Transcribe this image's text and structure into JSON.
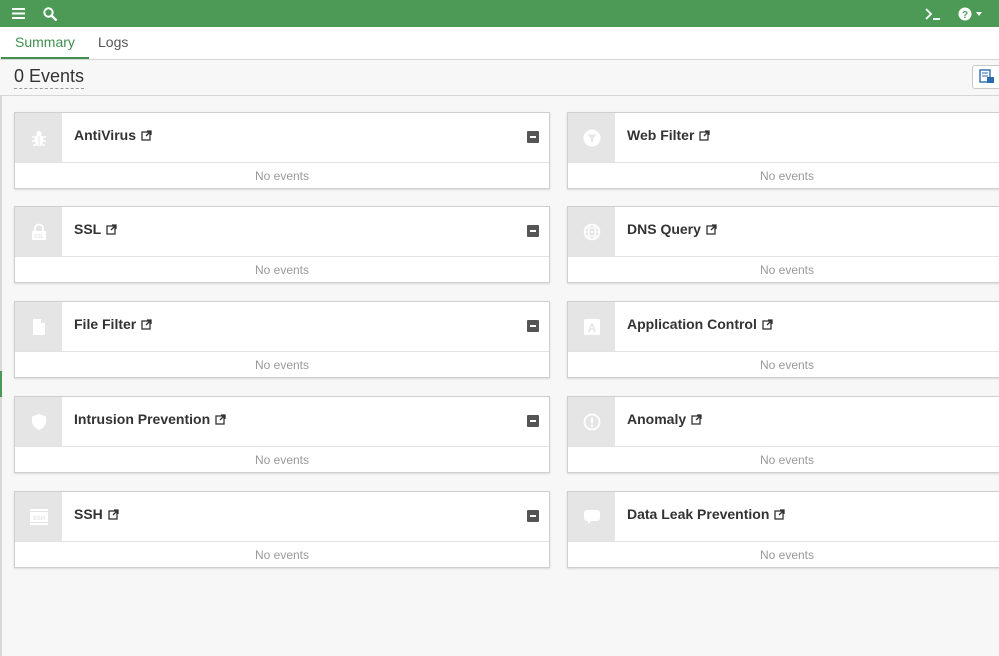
{
  "topbar": {
    "menu_icon": "hamburger-menu-icon",
    "search_icon": "search-icon",
    "cli_icon": "terminal-icon",
    "help_icon": "help-icon",
    "color": "#4d9a57"
  },
  "tabs": [
    {
      "label": "Summary",
      "active": true
    },
    {
      "label": "Logs",
      "active": false
    }
  ],
  "toolbar": {
    "events_count": "0 Events",
    "export_icon": "export-icon"
  },
  "cards": [
    {
      "title": "AntiVirus",
      "icon": "bug-icon",
      "body": "No events"
    },
    {
      "title": "Web Filter",
      "icon": "filter-icon",
      "body": "No events"
    },
    {
      "title": "SSL",
      "icon": "ssl-lock-icon",
      "body": "No events"
    },
    {
      "title": "DNS Query",
      "icon": "globe-icon",
      "body": "No events"
    },
    {
      "title": "File Filter",
      "icon": "file-icon",
      "body": "No events"
    },
    {
      "title": "Application Control",
      "icon": "application-icon",
      "body": "No events"
    },
    {
      "title": "Intrusion Prevention",
      "icon": "shield-icon",
      "body": "No events"
    },
    {
      "title": "Anomaly",
      "icon": "exclamation-circle-icon",
      "body": "No events"
    },
    {
      "title": "SSH",
      "icon": "ssh-icon",
      "body": "No events"
    },
    {
      "title": "Data Leak Prevention",
      "icon": "speech-bubble-icon",
      "body": "No events"
    }
  ]
}
